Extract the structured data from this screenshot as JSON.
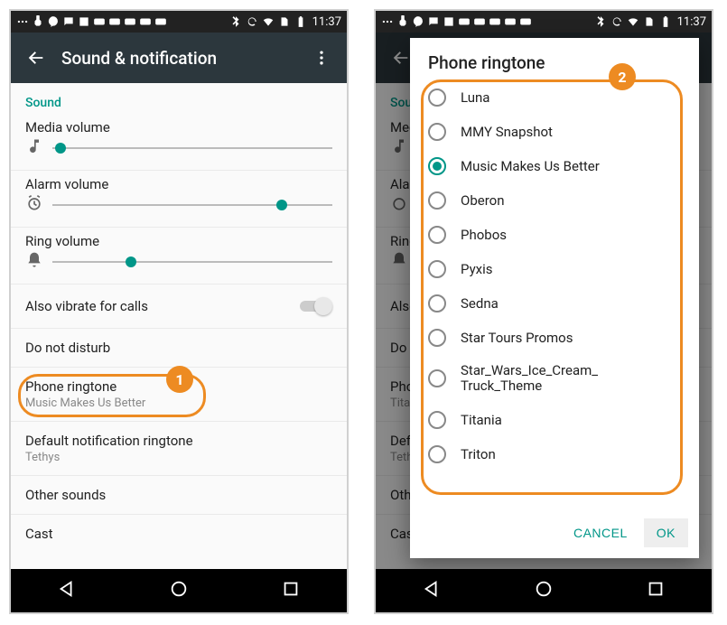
{
  "status": {
    "time": "11:37"
  },
  "appbar": {
    "title": "Sound & notification"
  },
  "section": {
    "sound": "Sound"
  },
  "sliders": {
    "media": {
      "label": "Media volume",
      "pos": 3
    },
    "alarm": {
      "label": "Alarm volume",
      "pos": 82
    },
    "ring": {
      "label": "Ring volume",
      "pos": 28
    }
  },
  "rows": {
    "vibrate": {
      "label": "Also vibrate for calls"
    },
    "dnd": {
      "label": "Do not disturb"
    },
    "ringtone": {
      "label": "Phone ringtone",
      "value": "Music Makes Us Better"
    },
    "notif": {
      "label": "Default notification ringtone",
      "value": "Tethys"
    },
    "other": {
      "label": "Other sounds"
    },
    "cast": {
      "label": "Cast"
    }
  },
  "dialog": {
    "title": "Phone ringtone",
    "options": [
      {
        "label": "Luna",
        "selected": false
      },
      {
        "label": "MMY Snapshot",
        "selected": false
      },
      {
        "label": "Music Makes Us Better",
        "selected": true
      },
      {
        "label": "Oberon",
        "selected": false
      },
      {
        "label": "Phobos",
        "selected": false
      },
      {
        "label": "Pyxis",
        "selected": false
      },
      {
        "label": "Sedna",
        "selected": false
      },
      {
        "label": "Star Tours Promos",
        "selected": false
      },
      {
        "label": "Star_Wars_Ice_Cream_\nTruck_Theme",
        "selected": false
      },
      {
        "label": "Titania",
        "selected": false
      },
      {
        "label": "Triton",
        "selected": false
      }
    ],
    "cancel": "CANCEL",
    "ok": "OK"
  },
  "right_bg_ringtone_value": "Titania",
  "annotations": {
    "one": "1",
    "two": "2"
  }
}
